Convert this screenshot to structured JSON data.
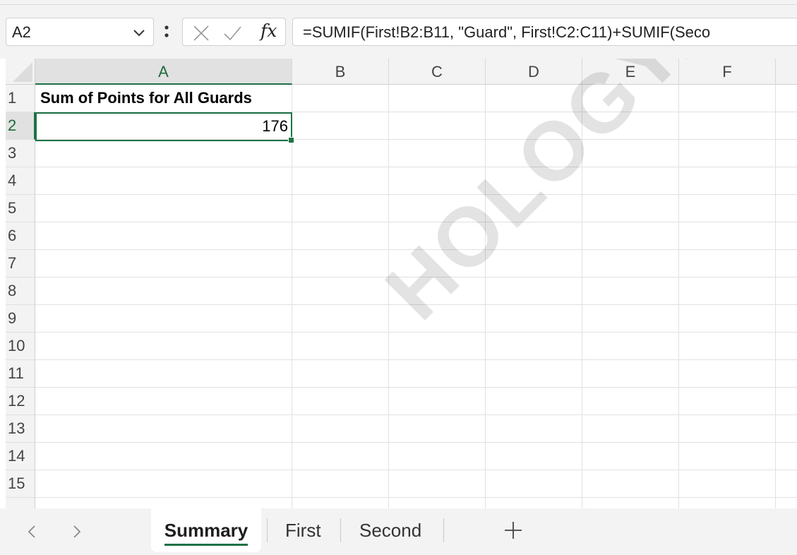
{
  "formula_bar": {
    "name_box": "A2",
    "fx_label": "fx",
    "formula": "=SUMIF(First!B2:B11, \"Guard\", First!C2:C11)+SUMIF(Seco"
  },
  "grid": {
    "columns": [
      "A",
      "B",
      "C",
      "D",
      "E",
      "F"
    ],
    "selected_column": "A",
    "rows": [
      "1",
      "2",
      "3",
      "4",
      "5",
      "6",
      "7",
      "8",
      "9",
      "10",
      "11",
      "12",
      "13",
      "14",
      "15"
    ],
    "selected_row": "2",
    "cells": {
      "A1": "Sum of Points for All Guards",
      "A2": "176"
    }
  },
  "watermark": "HOLOGY.COM",
  "sheet_tabs": {
    "tabs": [
      {
        "label": "Summary",
        "active": true
      },
      {
        "label": "First",
        "active": false
      },
      {
        "label": "Second",
        "active": false
      }
    ],
    "add_label": "+"
  },
  "colors": {
    "accent": "#1e7145",
    "header_bg": "#f3f3f3",
    "gridline": "#e1e1e1"
  }
}
